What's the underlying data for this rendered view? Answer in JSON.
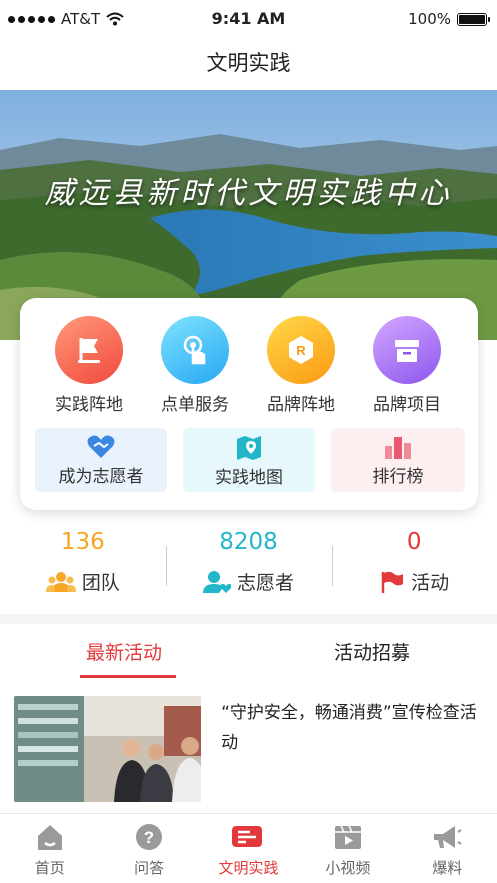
{
  "status_bar": {
    "carrier": "AT&T",
    "time": "9:41 AM",
    "battery": "100%"
  },
  "nav": {
    "title": "文明实践"
  },
  "hero": {
    "banner_text": "威远县新时代文明实践中心"
  },
  "quick_grid": [
    {
      "label": "实践阵地",
      "icon": "flag-icon",
      "color": "#f0483c"
    },
    {
      "label": "点单服务",
      "icon": "tap-icon",
      "color": "#26a6f2"
    },
    {
      "label": "品牌阵地",
      "icon": "brand-badge-icon",
      "color": "#fb9a12"
    },
    {
      "label": "品牌项目",
      "icon": "box-icon",
      "color": "#8c55ee"
    }
  ],
  "quick_row": [
    {
      "label": "成为志愿者",
      "icon": "heart-hands-icon"
    },
    {
      "label": "实践地图",
      "icon": "map-icon"
    },
    {
      "label": "排行榜",
      "icon": "bar-chart-icon"
    }
  ],
  "stats": [
    {
      "value": "136",
      "label": "团队",
      "color": "#f5a623"
    },
    {
      "value": "8208",
      "label": "志愿者",
      "color": "#22b6c9"
    },
    {
      "value": "0",
      "label": "活动",
      "color": "#e4393c"
    }
  ],
  "tabs": [
    {
      "label": "最新活动",
      "active": true
    },
    {
      "label": "活动招募",
      "active": false
    }
  ],
  "article": {
    "title": "“守护安全，畅通消费”宣传检查活动"
  },
  "tabbar": [
    {
      "label": "首页",
      "icon": "home-icon",
      "active": false
    },
    {
      "label": "问答",
      "icon": "question-icon",
      "active": false
    },
    {
      "label": "文明实践",
      "icon": "practice-flag-icon",
      "active": true
    },
    {
      "label": "小视频",
      "icon": "video-icon",
      "active": false
    },
    {
      "label": "爆料",
      "icon": "megaphone-icon",
      "active": false
    }
  ]
}
